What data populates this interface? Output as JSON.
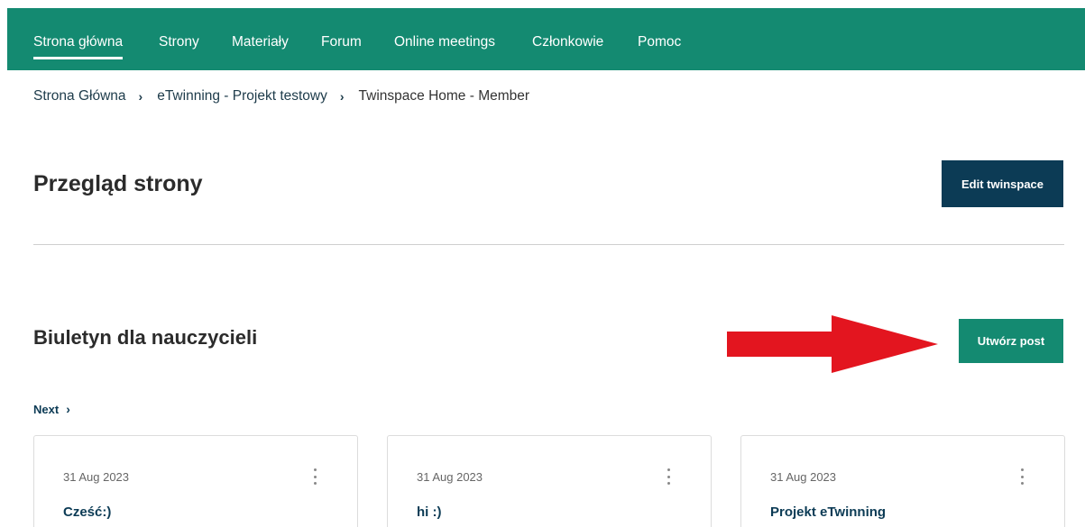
{
  "nav": {
    "items": [
      {
        "label": "Strona główna"
      },
      {
        "label": "Strony"
      },
      {
        "label": "Materiały"
      },
      {
        "label": "Forum"
      },
      {
        "label": "Online meetings"
      },
      {
        "label": "Członkowie"
      },
      {
        "label": "Pomoc"
      }
    ]
  },
  "breadcrumb": {
    "items": [
      "Strona Główna",
      "eTwinning - Projekt testowy",
      "Twinspace Home - Member"
    ],
    "separator": "›"
  },
  "page": {
    "title": "Przegląd strony",
    "edit_button": "Edit twinspace"
  },
  "bulletin": {
    "title": "Biuletyn dla nauczycieli",
    "create_button": "Utwórz post",
    "next_label": "Next",
    "posts": [
      {
        "date": "31 Aug 2023",
        "title": "Cześć:)"
      },
      {
        "date": "31 Aug 2023",
        "title": "hi :)"
      },
      {
        "date": "31 Aug 2023",
        "title": "Projekt eTwinning"
      }
    ]
  },
  "colors": {
    "nav_bg": "#148a71",
    "primary_dark": "#0c3b55",
    "accent_green": "#148a71",
    "arrow_red": "#e3151f"
  },
  "icons": {
    "breadcrumb_separator": "chevron-right-icon",
    "next": "chevron-right-icon",
    "card_menu": "kebab-menu-icon",
    "annotation": "red-arrow"
  }
}
